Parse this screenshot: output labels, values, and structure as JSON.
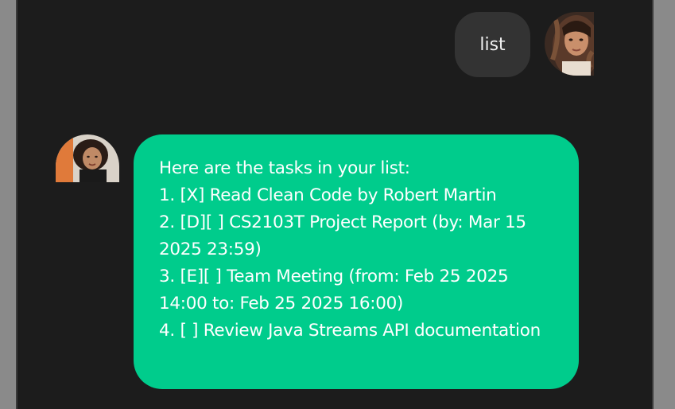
{
  "chat": {
    "messages": [
      {
        "sender": "user",
        "text": "list"
      },
      {
        "sender": "bot",
        "lines": [
          "Here are the tasks in your list:",
          "1. [X] Read Clean Code by Robert Martin",
          "2. [D][ ] CS2103T Project Report (by: Mar 15 2025 23:59)",
          "3. [E][ ] Team Meeting (from: Feb 25 2025 14:00 to: Feb 25 2025 16:00)",
          "4. [ ] Review Java Streams API documentation"
        ]
      }
    ]
  },
  "colors": {
    "background": "#1c1c1c",
    "user_bubble": "#333333",
    "bot_bubble": "#00cc8c",
    "text": "#ffffff"
  }
}
